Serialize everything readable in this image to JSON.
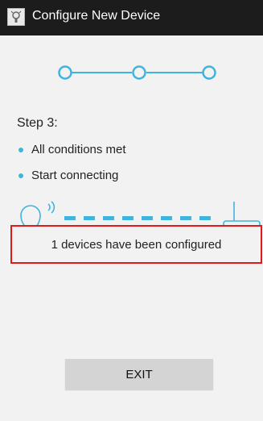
{
  "titlebar": {
    "title": "Configure New Device",
    "icon": "app-settings-icon"
  },
  "stepper": {
    "steps": 3,
    "current_step": 3,
    "accent_color": "#3fb4df"
  },
  "content": {
    "step_label": "Step 3:",
    "bullets": [
      {
        "text": "All conditions met"
      },
      {
        "text": "Start connecting"
      }
    ],
    "connection": {
      "left_icon": "lightbulb-signal-icon",
      "right_icon": "router-icon"
    },
    "status_message": "1 devices have been configured"
  },
  "actions": {
    "exit_label": "EXIT"
  },
  "colors": {
    "titlebar_bg": "#1c1c1c",
    "background": "#f2f2f2",
    "accent": "#3fb4df",
    "highlight_border": "#e01a1a",
    "button_bg": "#d4d4d4"
  }
}
